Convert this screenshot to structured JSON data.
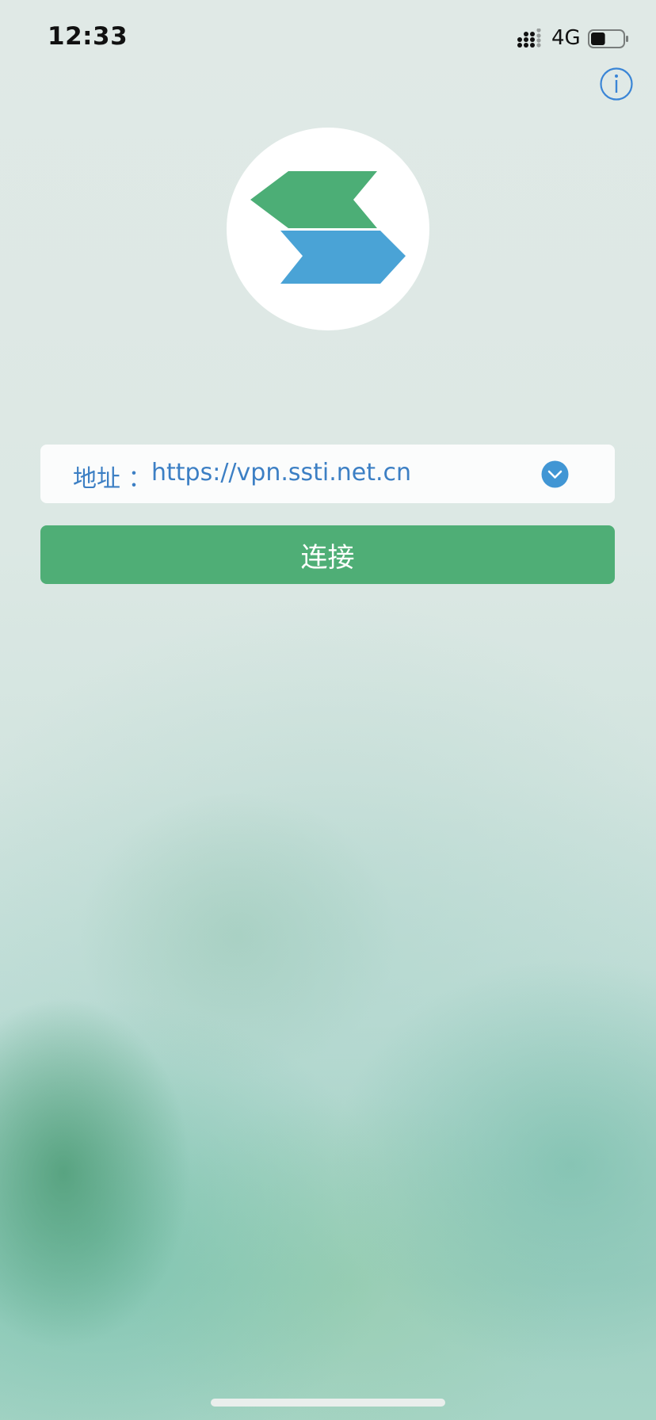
{
  "status_bar": {
    "time": "12:33",
    "network": "4G",
    "signal_icon": "cellular-signal-icon",
    "battery_icon": "battery-icon",
    "battery_level": 0.45
  },
  "header": {
    "info_icon": "info-icon"
  },
  "logo": {
    "icon": "app-logo",
    "colors": {
      "green": "#4cae76",
      "blue": "#4aa3d6"
    }
  },
  "address": {
    "label": "地址 ：",
    "value": "https://vpn.ssti.net.cn",
    "dropdown_icon": "chevron-down-icon",
    "text_color": "#3c7fc4"
  },
  "connect_button": {
    "label": "连接",
    "color": "#4fae76"
  }
}
